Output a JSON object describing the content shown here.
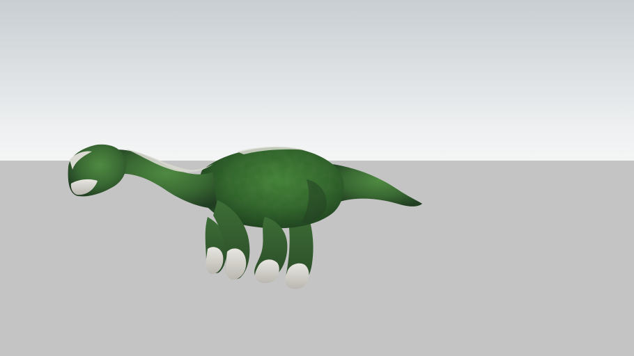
{
  "scene": {
    "sky_top_color": "#c8ced2",
    "sky_horizon_color": "#f4f5f5",
    "ground_color": "#c4c4c4",
    "model_skin_color": "#3f6b35",
    "model_underside_color": "#d9d9d4"
  }
}
